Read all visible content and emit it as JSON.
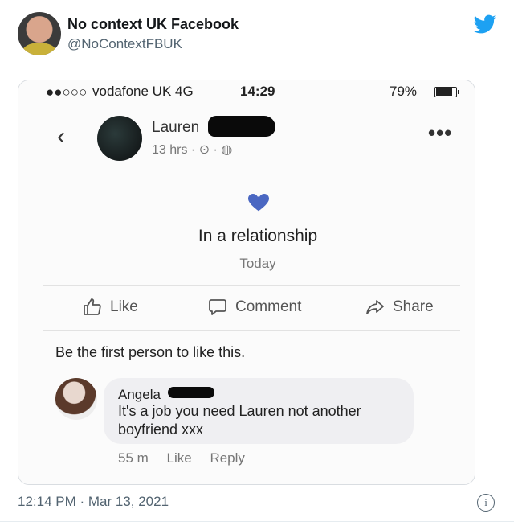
{
  "tweet": {
    "display_name": "No context UK Facebook",
    "handle": "@NoContextFBUK",
    "timestamp": "12:14 PM · Mar 13, 2021",
    "brand_color": "#1DA1F2"
  },
  "phone": {
    "signal": "●●○○○",
    "carrier": "vodafone UK  4G",
    "time": "14:29",
    "battery": "79%"
  },
  "post": {
    "author": "Lauren",
    "meta": "13 hrs · ⊙ · ◍",
    "more": "•••",
    "event_text": "In a relationship",
    "event_date": "Today",
    "heart_color": "#4a67c2",
    "actions": {
      "like": "Like",
      "comment": "Comment",
      "share": "Share"
    },
    "likes_text": "Be the first person to like this."
  },
  "comment": {
    "author": "Angela",
    "text": "It's a job you need Lauren not another boyfriend xxx",
    "time": "55 m",
    "like": "Like",
    "reply": "Reply"
  }
}
